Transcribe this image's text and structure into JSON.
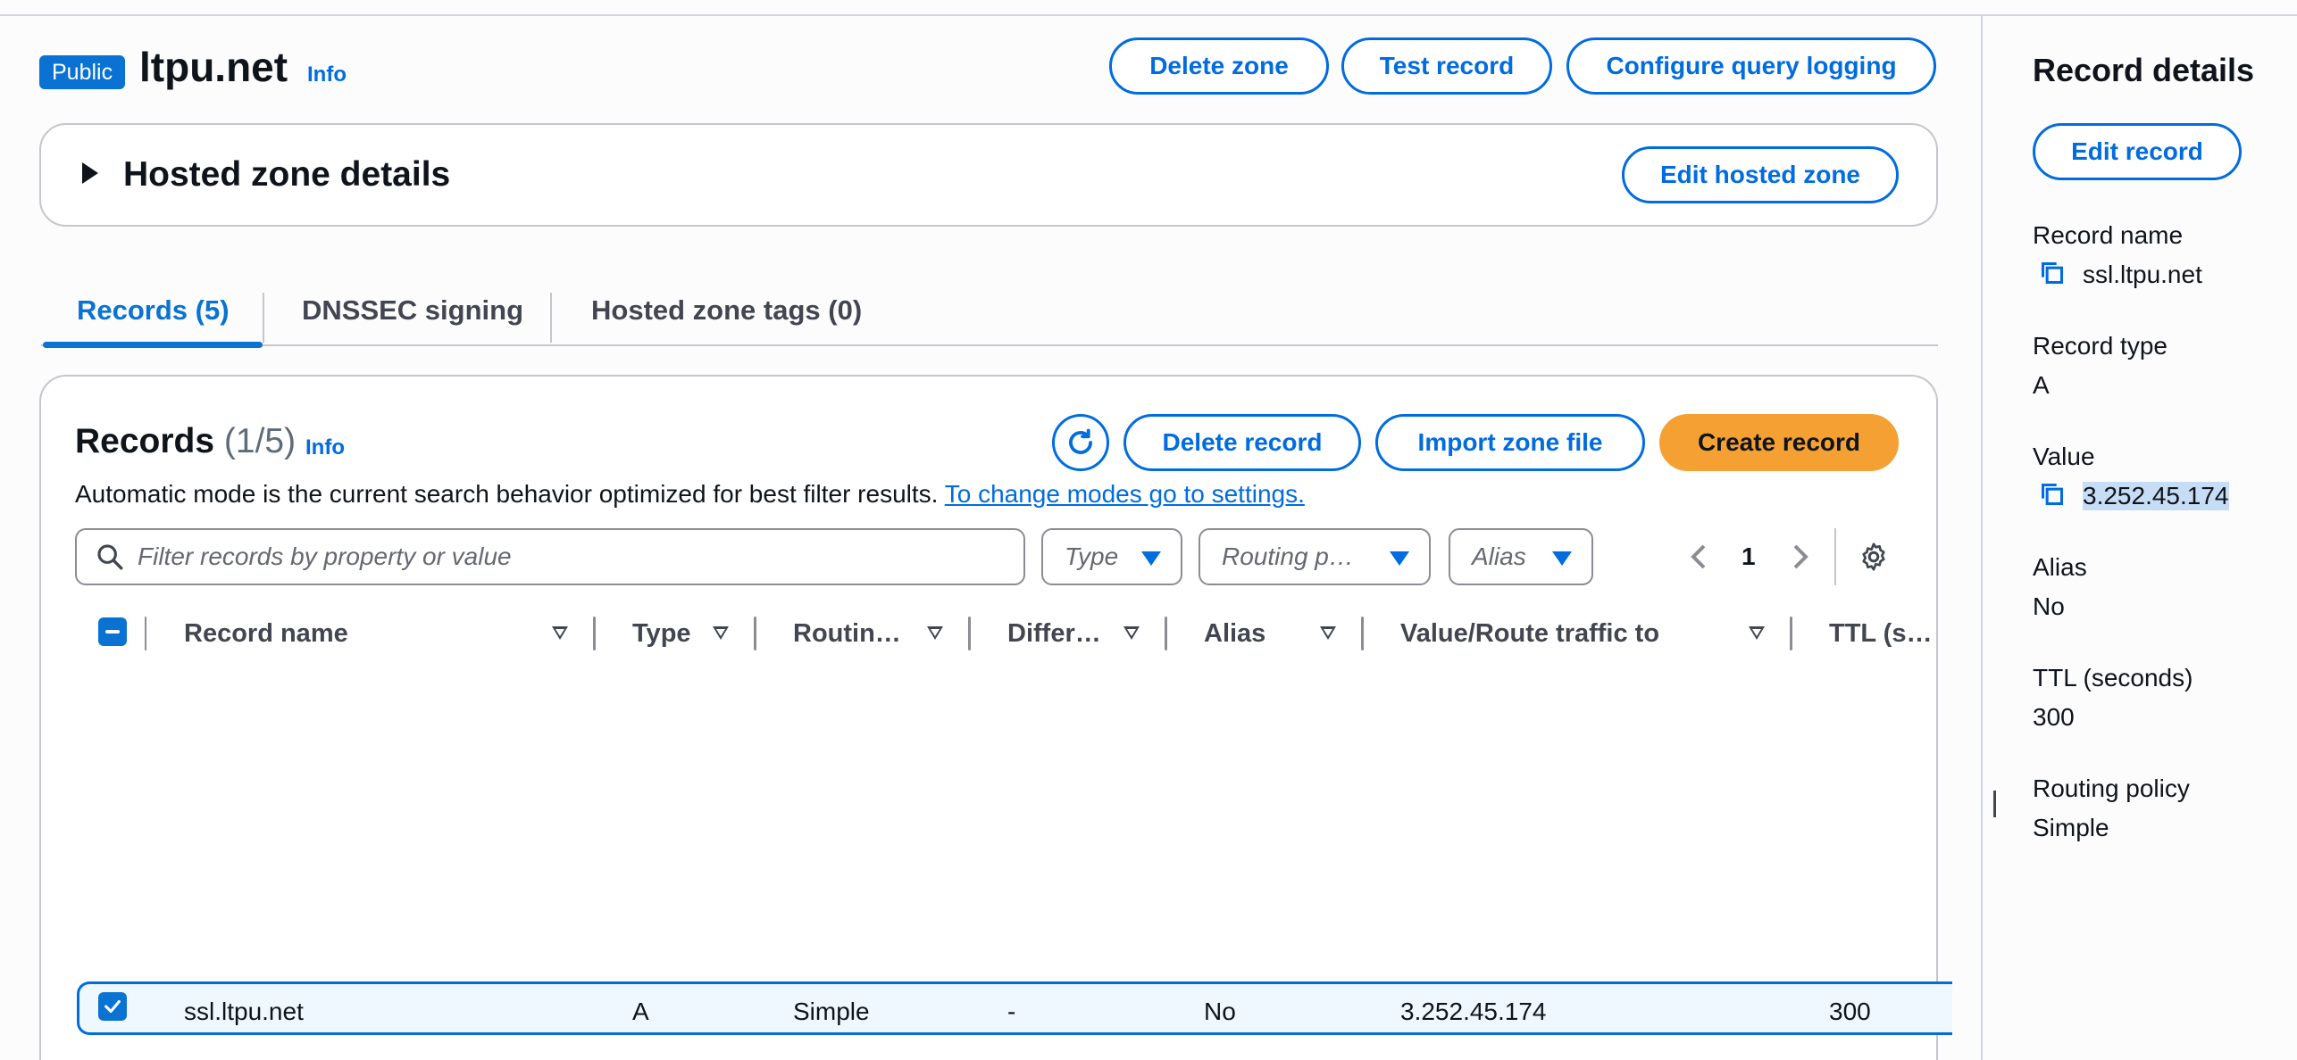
{
  "zone": {
    "badge": "Public",
    "name": "ltpu.net",
    "info": "Info",
    "actions": {
      "delete_zone": "Delete zone",
      "test_record": "Test record",
      "configure_query_logging": "Configure query logging"
    }
  },
  "hosted_zone_details": {
    "title": "Hosted zone details",
    "edit_button": "Edit hosted zone"
  },
  "tabs": [
    {
      "label": "Records (5)",
      "active": true
    },
    {
      "label": "DNSSEC signing",
      "active": false
    },
    {
      "label": "Hosted zone tags (0)",
      "active": false
    }
  ],
  "records": {
    "title": "Records",
    "count": "(1/5)",
    "info": "Info",
    "description": "Automatic mode is the current search behavior optimized for best filter results.",
    "settings_link": "To change modes go to settings.",
    "buttons": {
      "delete": "Delete record",
      "import": "Import zone file",
      "create": "Create record"
    },
    "search_placeholder": "Filter records by property or value",
    "filters": {
      "type": "Type",
      "routing": "Routing p…",
      "alias": "Alias"
    },
    "page": "1",
    "columns": {
      "record_name": "Record name",
      "type": "Type",
      "routing": "Routin…",
      "differ": "Differ…",
      "alias": "Alias",
      "value": "Value/Route traffic to",
      "ttl": "TTL (s…"
    },
    "rows": [
      {
        "record_name": "ssl.ltpu.net",
        "type": "A",
        "routing": "Simple",
        "differ": "-",
        "alias": "No",
        "value": "3.252.45.174",
        "ttl": "300",
        "selected": true
      }
    ]
  },
  "record_details": {
    "title": "Record details",
    "edit_button": "Edit record",
    "fields": {
      "record_name_label": "Record name",
      "record_name": "ssl.ltpu.net",
      "record_type_label": "Record type",
      "record_type": "A",
      "value_label": "Value",
      "value": "3.252.45.174",
      "alias_label": "Alias",
      "alias": "No",
      "ttl_label": "TTL (seconds)",
      "ttl": "300",
      "routing_label": "Routing policy",
      "routing": "Simple"
    }
  },
  "colors": {
    "link": "#006ce0",
    "primary": "#f5a033",
    "badge": "#0972d3"
  }
}
